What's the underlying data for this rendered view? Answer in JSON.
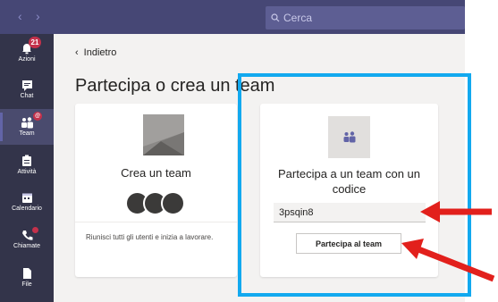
{
  "header": {
    "search_placeholder": "Cerca"
  },
  "rail": {
    "items": [
      {
        "label": "Azioni",
        "badge": "21",
        "icon": "bell-icon"
      },
      {
        "label": "Chat",
        "icon": "chat-icon"
      },
      {
        "label": "Team",
        "icon": "teams-icon",
        "active": true
      },
      {
        "label": "Attività",
        "icon": "assignments-icon"
      },
      {
        "label": "Calendario",
        "icon": "calendar-icon"
      },
      {
        "label": "Chiamate",
        "icon": "phone-icon"
      },
      {
        "label": "File",
        "icon": "file-icon"
      }
    ]
  },
  "main": {
    "back_label": "Indietro",
    "title": "Partecipa o crea un team",
    "create_card": {
      "title": "Crea un team",
      "description": "Riunisci tutti gli utenti e inizia a lavorare."
    },
    "join_card": {
      "title": "Partecipa a un team con un codice",
      "code_value": "3psqin8",
      "button_label": "Partecipa al team"
    }
  },
  "colors": {
    "titlebar": "#464775",
    "rail": "#33344a",
    "highlight": "#12a9ef",
    "arrow": "#e2201c",
    "badge": "#c4314b"
  }
}
